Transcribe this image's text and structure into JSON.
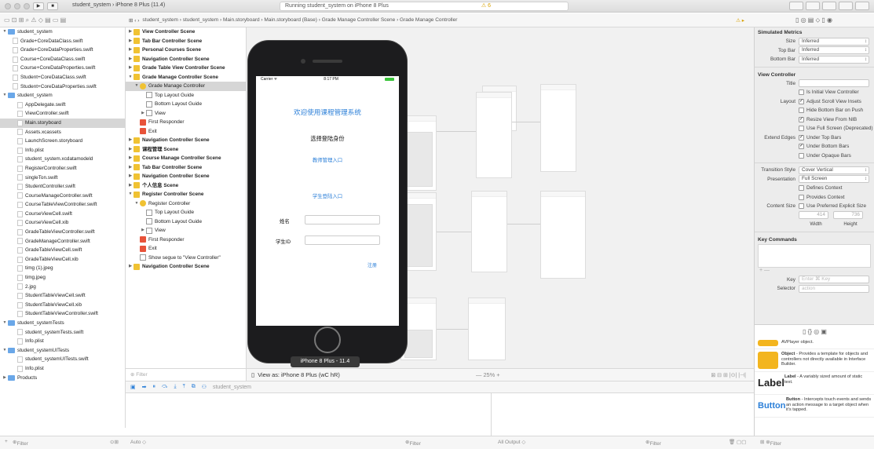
{
  "titlebar": {
    "scheme": "student_system  ›  iPhone 8 Plus (11.4)",
    "status": "Running student_system on iPhone 8 Plus",
    "warning_count": "⚠ 6"
  },
  "jumpbar": {
    "path": "student_system  ›  student_system  ›  Main.storyboard  ›  Main.storyboard (Base)  ›  Grade Manage Controller Scene  ›  Grade Manage Controller",
    "warning": "⚠ ▸"
  },
  "navigator": {
    "items": [
      {
        "label": "student_system",
        "indent": 0,
        "kind": "folder",
        "tri": "▼"
      },
      {
        "label": "Grade+CoreDataClass.swift",
        "indent": 1,
        "kind": "file"
      },
      {
        "label": "Grade+CoreDataProperties.swift",
        "indent": 1,
        "kind": "file"
      },
      {
        "label": "Course+CoreDataClass.swift",
        "indent": 1,
        "kind": "file"
      },
      {
        "label": "Course+CoreDataProperties.swift",
        "indent": 1,
        "kind": "file"
      },
      {
        "label": "Student+CoreDataClass.swift",
        "indent": 1,
        "kind": "file"
      },
      {
        "label": "Student+CoreDataProperties.swift",
        "indent": 1,
        "kind": "file"
      },
      {
        "label": "student_system",
        "indent": 0,
        "kind": "folder",
        "tri": "▼"
      },
      {
        "label": "AppDelegate.swift",
        "indent": 2,
        "kind": "file"
      },
      {
        "label": "ViewController.swift",
        "indent": 2,
        "kind": "file"
      },
      {
        "label": "Main.storyboard",
        "indent": 2,
        "kind": "file",
        "selected": true
      },
      {
        "label": "Assets.xcassets",
        "indent": 2,
        "kind": "file"
      },
      {
        "label": "LaunchScreen.storyboard",
        "indent": 2,
        "kind": "file"
      },
      {
        "label": "Info.plist",
        "indent": 2,
        "kind": "file"
      },
      {
        "label": "student_system.xcdatamodeld",
        "indent": 2,
        "kind": "file"
      },
      {
        "label": "RegisterController.swift",
        "indent": 2,
        "kind": "file"
      },
      {
        "label": "singleTon.swift",
        "indent": 2,
        "kind": "file"
      },
      {
        "label": "StudentController.swift",
        "indent": 2,
        "kind": "file"
      },
      {
        "label": "CourseManageController.swift",
        "indent": 2,
        "kind": "file"
      },
      {
        "label": "CourseTableViewController.swift",
        "indent": 2,
        "kind": "file"
      },
      {
        "label": "CourseViewCell.swift",
        "indent": 2,
        "kind": "file"
      },
      {
        "label": "CourseViewCell.xib",
        "indent": 2,
        "kind": "file"
      },
      {
        "label": "GradeTableViewController.swift",
        "indent": 2,
        "kind": "file"
      },
      {
        "label": "GradeManageController.swift",
        "indent": 2,
        "kind": "file"
      },
      {
        "label": "GradeTableViewCell.swift",
        "indent": 2,
        "kind": "file"
      },
      {
        "label": "GradeTableViewCell.xib",
        "indent": 2,
        "kind": "file"
      },
      {
        "label": "timg (1).jpeg",
        "indent": 2,
        "kind": "file"
      },
      {
        "label": "timg.jpeg",
        "indent": 2,
        "kind": "file"
      },
      {
        "label": "2.jpg",
        "indent": 2,
        "kind": "file"
      },
      {
        "label": "StudentTableViewCell.swift",
        "indent": 2,
        "kind": "file"
      },
      {
        "label": "StudentTableViewCell.xib",
        "indent": 2,
        "kind": "file"
      },
      {
        "label": "StudentTableViewController.swift",
        "indent": 2,
        "kind": "file"
      },
      {
        "label": "student_systemTests",
        "indent": 0,
        "kind": "folder",
        "tri": "▼"
      },
      {
        "label": "student_systemTests.swift",
        "indent": 2,
        "kind": "file"
      },
      {
        "label": "Info.plist",
        "indent": 2,
        "kind": "file"
      },
      {
        "label": "student_systemUITests",
        "indent": 0,
        "kind": "folder",
        "tri": "▼"
      },
      {
        "label": "student_systemUITests.swift",
        "indent": 2,
        "kind": "file"
      },
      {
        "label": "Info.plist",
        "indent": 2,
        "kind": "file"
      },
      {
        "label": "Products",
        "indent": 0,
        "kind": "folder",
        "tri": "▶"
      }
    ]
  },
  "outline": {
    "items": [
      {
        "label": "View Controller Scene",
        "kind": "scene",
        "tri": "▶",
        "indent": 0
      },
      {
        "label": "Tab Bar Controller Scene",
        "kind": "scene",
        "tri": "▶",
        "indent": 0
      },
      {
        "label": "Personal Courses Scene",
        "kind": "scene",
        "tri": "▶",
        "indent": 0
      },
      {
        "label": "Navigation Controller Scene",
        "kind": "scene",
        "tri": "▶",
        "indent": 0
      },
      {
        "label": "Grade Table View Controller Scene",
        "kind": "scene",
        "tri": "▶",
        "indent": 0
      },
      {
        "label": "Grade Manage Controller Scene",
        "kind": "scene",
        "tri": "▼",
        "indent": 0
      },
      {
        "label": "Grade Manage Controller",
        "kind": "ylc",
        "tri": "▼",
        "indent": 1,
        "selected": true
      },
      {
        "label": "Top Layout Guide",
        "kind": "wbox",
        "indent": 2
      },
      {
        "label": "Bottom Layout Guide",
        "kind": "wbox",
        "indent": 2
      },
      {
        "label": "View",
        "kind": "wbox",
        "tri": "▶",
        "indent": 2
      },
      {
        "label": "First Responder",
        "kind": "red",
        "indent": 1
      },
      {
        "label": "Exit",
        "kind": "red",
        "indent": 1
      },
      {
        "label": "Navigation Controller Scene",
        "kind": "scene",
        "tri": "▶",
        "indent": 0
      },
      {
        "label": "课程管理 Scene",
        "kind": "scene",
        "tri": "▶",
        "indent": 0
      },
      {
        "label": "Course Manage Controller Scene",
        "kind": "scene",
        "tri": "▶",
        "indent": 0
      },
      {
        "label": "Tab Bar Controller Scene",
        "kind": "scene",
        "tri": "▶",
        "indent": 0
      },
      {
        "label": "Navigation Controller Scene",
        "kind": "scene",
        "tri": "▶",
        "indent": 0
      },
      {
        "label": "个人信息 Scene",
        "kind": "scene",
        "tri": "▶",
        "indent": 0
      },
      {
        "label": "Register Controller Scene",
        "kind": "scene",
        "tri": "▼",
        "indent": 0
      },
      {
        "label": "Register Controller",
        "kind": "ylc",
        "tri": "▼",
        "indent": 1
      },
      {
        "label": "Top Layout Guide",
        "kind": "wbox",
        "indent": 2
      },
      {
        "label": "Bottom Layout Guide",
        "kind": "wbox",
        "indent": 2
      },
      {
        "label": "View",
        "kind": "wbox",
        "tri": "▶",
        "indent": 2
      },
      {
        "label": "First Responder",
        "kind": "red",
        "indent": 1
      },
      {
        "label": "Exit",
        "kind": "red",
        "indent": 1
      },
      {
        "label": "Show segue to \"View Controller\"",
        "kind": "wbox",
        "indent": 1
      },
      {
        "label": "Navigation Controller Scene",
        "kind": "scene",
        "tri": "▶",
        "indent": 0
      }
    ],
    "filter_placeholder": "Filter"
  },
  "phone": {
    "carrier": "Carrier ᯤ",
    "time": "8:17 PM",
    "title": "欢迎使用课程管理系统",
    "choose_role": "选择登陆身份",
    "teacher_entry": "教师管理入口",
    "student_entry": "学生登陆入口",
    "name_label": "姓名",
    "student_id_label": "学生ID",
    "register": "注册",
    "device_tooltip": "iPhone 8 Plus - 11.4"
  },
  "canvas_bar": {
    "view_as": "View as: iPhone 8 Plus (wC hR)",
    "zoom": "—   25%   +"
  },
  "debug": {
    "target": "student_system"
  },
  "bottom": {
    "filter": "Filter",
    "auto": "Auto ◇",
    "all_output": "All Output ◇",
    "filter2": "Filter",
    "filter3": "Filter"
  },
  "inspector": {
    "simulated_metrics": "Simulated Metrics",
    "size_label": "Size",
    "size_value": "Inferred",
    "topbar_label": "Top Bar",
    "topbar_value": "Inferred",
    "bottombar_label": "Bottom Bar",
    "bottombar_value": "Inferred",
    "view_controller": "View Controller",
    "title_label": "Title",
    "is_initial": "Is Initial View Controller",
    "layout_label": "Layout",
    "adjust_scroll": "Adjust Scroll View Insets",
    "hide_bottom_bar": "Hide Bottom Bar on Push",
    "resize_nib": "Resize View From NIB",
    "full_screen": "Use Full Screen (Deprecated)",
    "extend_edges_label": "Extend Edges",
    "under_top": "Under Top Bars",
    "under_bottom": "Under Bottom Bars",
    "under_opaque": "Under Opaque Bars",
    "transition_label": "Transition Style",
    "transition_value": "Cover Vertical",
    "presentation_label": "Presentation",
    "presentation_value": "Full Screen",
    "defines_context": "Defines Context",
    "provides_context": "Provides Context",
    "content_size_label": "Content Size",
    "preferred_size": "Use Preferred Explicit Size",
    "width_value": "414",
    "height_value": "736",
    "width_label": "Width",
    "height_label": "Height",
    "key_commands": "Key Commands",
    "plus_minus": "+  —",
    "key_label": "Key",
    "key_placeholder": "Enter ⌘ Key",
    "selector_label": "Selector",
    "selector_placeholder": "action"
  },
  "library": {
    "avplayer": "AVPlayer object.",
    "object_title": "Object",
    "object_desc": " - Provides a template for objects and controllers not directly available in Interface Builder.",
    "label_big": "Label",
    "label_title": "Label",
    "label_desc": " - A variably sized amount of static text.",
    "button_big": "Button",
    "button_title": "Button",
    "button_desc": " - Intercepts touch events and sends an action message to a target object when it's tapped."
  },
  "icons": {
    "navigator": "▭ ⊡ ⊞ ⌕ ⚠ ◇ ▤ ▭ ▤",
    "inspector": "▯ ◎ ▤ ⬦ ▯ ◉",
    "library_tabs": "▯ {} ◎ ▣"
  },
  "colors": {
    "accent": "#2b7fd8",
    "warning": "#d7a000"
  }
}
